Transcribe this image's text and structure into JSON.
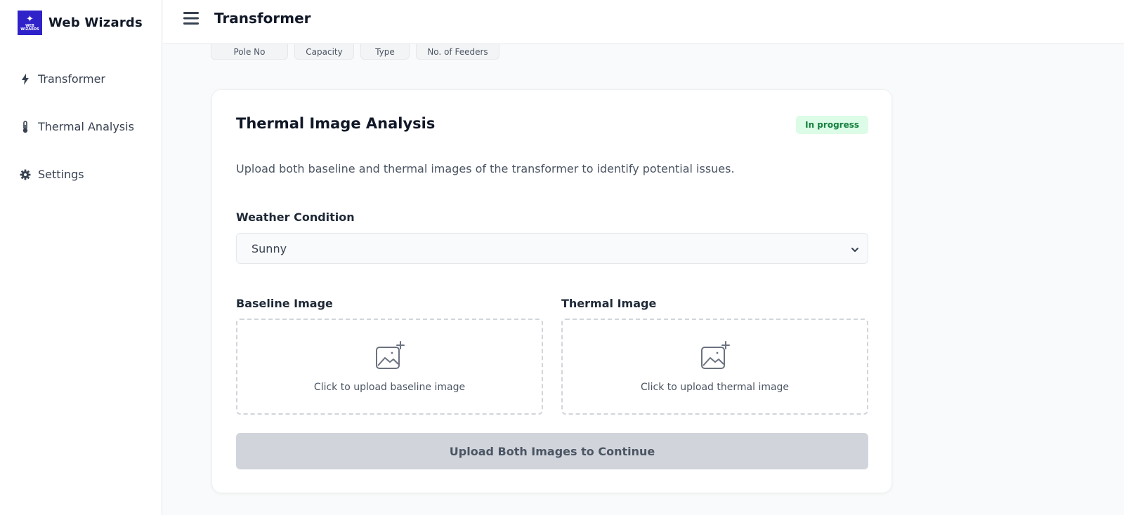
{
  "app": {
    "name": "Web Wizards",
    "logo_text": "WEB WIZARDS"
  },
  "sidebar": {
    "items": [
      {
        "label": "Transformer",
        "icon": "bolt-icon"
      },
      {
        "label": "Thermal Analysis",
        "icon": "thermometer-icon"
      },
      {
        "label": "Settings",
        "icon": "gear-icon"
      }
    ]
  },
  "header": {
    "title": "Transformer",
    "menu_icon": "hamburger-icon"
  },
  "table_headers": [
    "Pole No",
    "Capacity",
    "Type",
    "No. of Feeders"
  ],
  "analysis": {
    "title": "Thermal Image Analysis",
    "status": "In progress",
    "description": "Upload both baseline and thermal images of the transformer to identify potential issues.",
    "weather_label": "Weather Condition",
    "weather_value": "Sunny",
    "baseline_label": "Baseline Image",
    "baseline_hint": "Click to upload baseline image",
    "thermal_label": "Thermal Image",
    "thermal_hint": "Click to upload thermal image",
    "submit_label": "Upload Both Images to Continue"
  },
  "colors": {
    "brand": "#2f22c9",
    "status_bg": "#dcfce7",
    "status_text": "#15803d",
    "disabled_button": "#d1d5db"
  }
}
